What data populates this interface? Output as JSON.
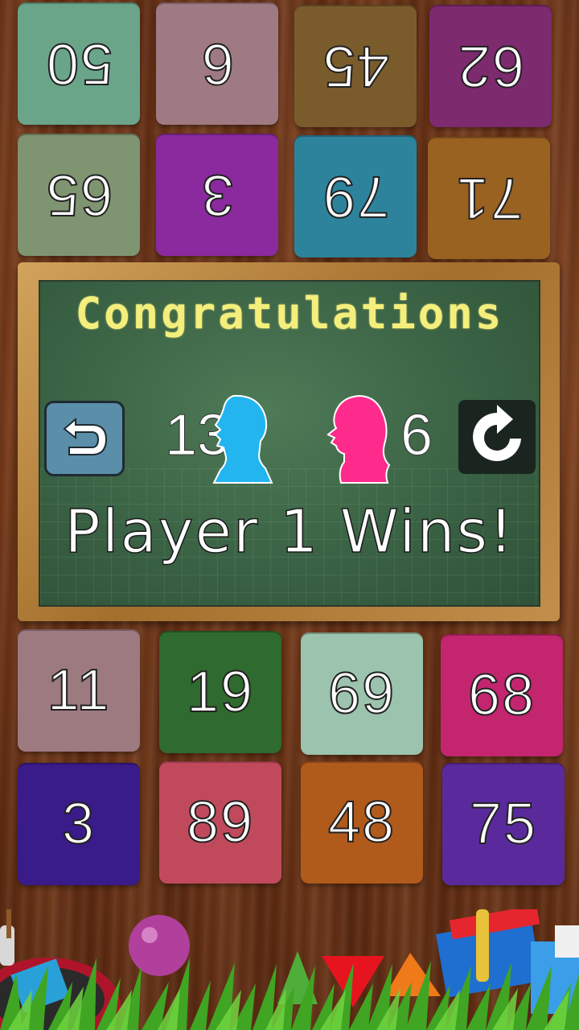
{
  "opponent_tiles": [
    {
      "value": "50",
      "color": "#6aa58a"
    },
    {
      "value": "6",
      "color": "#a07a82"
    },
    {
      "value": "45",
      "color": "#7a5c2c"
    },
    {
      "value": "62",
      "color": "#7d2a6f"
    },
    {
      "value": "65",
      "color": "#7f9470"
    },
    {
      "value": "3",
      "color": "#8a2a9e"
    },
    {
      "value": "79",
      "color": "#2d839c"
    },
    {
      "value": "71",
      "color": "#9a6220"
    }
  ],
  "player_tiles": [
    {
      "value": "11",
      "color": "#9c7a80"
    },
    {
      "value": "19",
      "color": "#2f6a2e"
    },
    {
      "value": "69",
      "color": "#9cc3ad"
    },
    {
      "value": "68",
      "color": "#c4256f"
    },
    {
      "value": "3",
      "color": "#3a1b8a"
    },
    {
      "value": "89",
      "color": "#c04a5c"
    },
    {
      "value": "48",
      "color": "#b05a1c"
    },
    {
      "value": "75",
      "color": "#5a2a9c"
    }
  ],
  "dialog": {
    "title": "Congratulations",
    "player1_score": "13",
    "player2_score": "6",
    "result": "Player 1 Wins!",
    "player1_color": "#22b5f0",
    "player2_color": "#ff2b8c"
  },
  "icons": {
    "undo": "undo-arrow-icon",
    "replay": "replay-icon",
    "player1": "boy-silhouette-icon",
    "player2": "girl-silhouette-icon",
    "down": "down-arrow-icon"
  }
}
